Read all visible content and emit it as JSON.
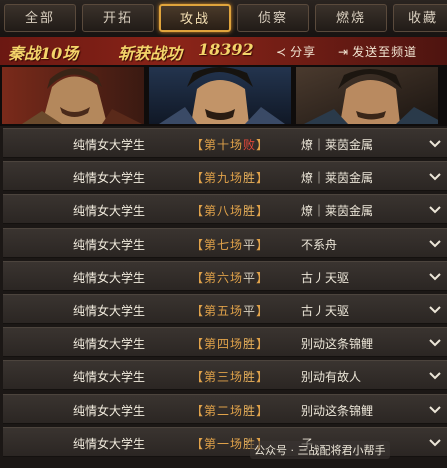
{
  "tabs": [
    "全部",
    "开拓",
    "攻战",
    "侦察",
    "燃烧",
    "收藏"
  ],
  "active_tab_index": 2,
  "header": {
    "season_label": "秦战10场",
    "merit_label": "斩获战功",
    "merit_value": "18392",
    "share_label": "分享",
    "send_label": "发送至频道"
  },
  "battles": [
    {
      "player": "纯情女大学生",
      "round": "【第十场",
      "result": "败",
      "result_type": "loss",
      "close": "】",
      "opponent": "燎｜莱茵金属"
    },
    {
      "player": "纯情女大学生",
      "round": "【第九场",
      "result": "胜",
      "result_type": "win",
      "close": "】",
      "opponent": "燎｜莱茵金属"
    },
    {
      "player": "纯情女大学生",
      "round": "【第八场",
      "result": "胜",
      "result_type": "win",
      "close": "】",
      "opponent": "燎｜莱茵金属"
    },
    {
      "player": "纯情女大学生",
      "round": "【第七场",
      "result": "平",
      "result_type": "draw",
      "close": "】",
      "opponent": "不系舟"
    },
    {
      "player": "纯情女大学生",
      "round": "【第六场",
      "result": "平",
      "result_type": "draw",
      "close": "】",
      "opponent": "古丿天驱"
    },
    {
      "player": "纯情女大学生",
      "round": "【第五场",
      "result": "平",
      "result_type": "draw",
      "close": "】",
      "opponent": "古丿天驱"
    },
    {
      "player": "纯情女大学生",
      "round": "【第四场",
      "result": "胜",
      "result_type": "win",
      "close": "】",
      "opponent": "别动这条锦鲤"
    },
    {
      "player": "纯情女大学生",
      "round": "【第三场",
      "result": "胜",
      "result_type": "win",
      "close": "】",
      "opponent": "别动有故人"
    },
    {
      "player": "纯情女大学生",
      "round": "【第二场",
      "result": "胜",
      "result_type": "win",
      "close": "】",
      "opponent": "别动这条锦鲤"
    },
    {
      "player": "纯情女大学生",
      "round": "【第一场",
      "result": "胜",
      "result_type": "win",
      "close": "】",
      "opponent": "子"
    }
  ],
  "watermark": "公众号 · 三战配将君小帮手",
  "colors": {
    "accent": "#e0a43c",
    "header_bg": "#8a2418",
    "win": "#e9b25c",
    "loss": "#e0483a"
  }
}
